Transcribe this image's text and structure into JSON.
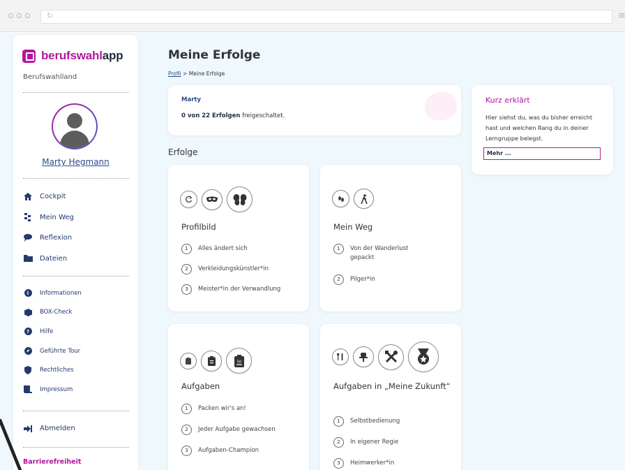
{
  "browser": {
    "reload_icon": "↻",
    "menu_icon": "≡"
  },
  "sidebar": {
    "logo_brand": "berufswahl",
    "logo_app": "app",
    "subtitle": "Berufswahlland",
    "user_name": "Marty Hegmann",
    "nav_primary": [
      {
        "label": "Cockpit",
        "icon": "home-icon"
      },
      {
        "label": "Mein Weg",
        "icon": "path-icon"
      },
      {
        "label": "Reflexion",
        "icon": "speech-icon"
      },
      {
        "label": "Dateien",
        "icon": "folder-icon"
      }
    ],
    "nav_secondary": [
      {
        "label": "Informationen",
        "icon": "info-icon"
      },
      {
        "label": "BOX-Check",
        "icon": "box-icon"
      },
      {
        "label": "Hilfe",
        "icon": "help-icon"
      },
      {
        "label": "Geführte Tour",
        "icon": "compass-icon"
      },
      {
        "label": "Rechtliches",
        "icon": "shield-icon"
      },
      {
        "label": "Impressum",
        "icon": "book-icon"
      }
    ],
    "logout_label": "Abmelden",
    "accessibility_label": "Barrierefreiheit"
  },
  "main": {
    "title": "Meine Erfolge",
    "breadcrumb_link": "Profil",
    "breadcrumb_sep": " > ",
    "breadcrumb_current": "Meine Erfolge",
    "user_card": {
      "name": "Marty",
      "count_bold": "0 von 22 Erfolgen",
      "count_rest": " freigeschaltet."
    },
    "section_title": "Erfolge",
    "achievements": [
      {
        "title": "Profilbild",
        "icons": [
          "refresh-icon",
          "mask-icon",
          "butterfly-icon"
        ],
        "steps": [
          {
            "num": "1",
            "text": "Alles ändert sich"
          },
          {
            "num": "2",
            "text": "Verkleidungskünstler*in"
          },
          {
            "num": "3",
            "text": "Meister*in der Verwandlung"
          }
        ]
      },
      {
        "title": "Mein Weg",
        "icons": [
          "footprint-icon",
          "hiker-icon"
        ],
        "steps": [
          {
            "num": "1",
            "text": "Von der Wanderlust gepackt"
          },
          {
            "num": "2",
            "text": "Pilger*in"
          }
        ]
      },
      {
        "title": "Aufgaben",
        "icons": [
          "clipboard-icon",
          "clipboard-list-icon",
          "clipboard-50-icon"
        ],
        "steps": [
          {
            "num": "1",
            "text": "Packen wir's an!"
          },
          {
            "num": "2",
            "text": "Jeder Aufgabe gewachsen"
          },
          {
            "num": "3",
            "text": "Aufgaben-Champion"
          }
        ]
      },
      {
        "title": "Aufgaben in „Meine Zukunft“",
        "icons": [
          "cutlery-icon",
          "chair-icon",
          "tools-icon",
          "medal-icon"
        ],
        "steps": [
          {
            "num": "1",
            "text": "Selbstbedienung"
          },
          {
            "num": "2",
            "text": "In eigener Regie"
          },
          {
            "num": "3",
            "text": "Heimwerker*in"
          }
        ]
      }
    ]
  },
  "info": {
    "title": "Kurz erklärt",
    "text": "Hier siehst du, was du bisher erreicht hast und welchen Rang du in deiner Lerngruppe belegst.",
    "more_label": "Mehr ..."
  },
  "colors": {
    "brand": "#b5179e",
    "navy": "#233a6b",
    "page_bg": "#eef8fd"
  }
}
